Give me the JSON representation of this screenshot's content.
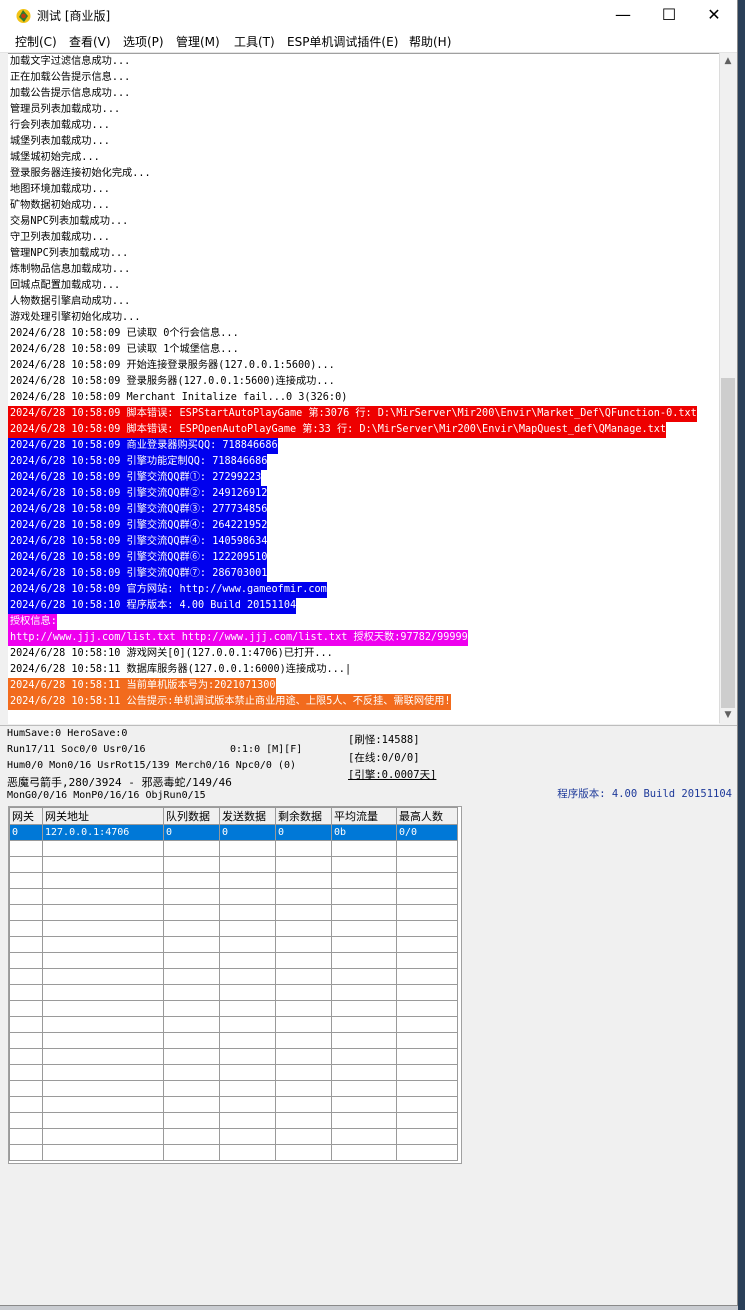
{
  "window": {
    "title": "测试 [商业版]"
  },
  "title_controls": {
    "minimize": "—",
    "maximize": "☐",
    "close": "✕"
  },
  "menu": [
    "控制(C)",
    "查看(V)",
    "选项(P)",
    "管理(M)",
    "工具(T)",
    "ESP单机调试插件(E)",
    "帮助(H)"
  ],
  "log_lines": [
    {
      "text": "加载文字过滤信息成功...",
      "bg": "#ffffff",
      "fg": "#000000"
    },
    {
      "text": "正在加载公告提示信息...",
      "bg": "#ffffff",
      "fg": "#000000"
    },
    {
      "text": "加载公告提示信息成功...",
      "bg": "#ffffff",
      "fg": "#000000"
    },
    {
      "text": "管理员列表加载成功...",
      "bg": "#ffffff",
      "fg": "#000000"
    },
    {
      "text": "行会列表加载成功...",
      "bg": "#ffffff",
      "fg": "#000000"
    },
    {
      "text": "城堡列表加载成功...",
      "bg": "#ffffff",
      "fg": "#000000"
    },
    {
      "text": "城堡城初始完成...",
      "bg": "#ffffff",
      "fg": "#000000"
    },
    {
      "text": "登录服务器连接初始化完成...",
      "bg": "#ffffff",
      "fg": "#000000"
    },
    {
      "text": "地图环境加载成功...",
      "bg": "#ffffff",
      "fg": "#000000"
    },
    {
      "text": "矿物数据初始成功...",
      "bg": "#ffffff",
      "fg": "#000000"
    },
    {
      "text": "交易NPC列表加载成功...",
      "bg": "#ffffff",
      "fg": "#000000"
    },
    {
      "text": "守卫列表加载成功...",
      "bg": "#ffffff",
      "fg": "#000000"
    },
    {
      "text": "管理NPC列表加载成功...",
      "bg": "#ffffff",
      "fg": "#000000"
    },
    {
      "text": "炼制物品信息加载成功...",
      "bg": "#ffffff",
      "fg": "#000000"
    },
    {
      "text": "回城点配置加载成功...",
      "bg": "#ffffff",
      "fg": "#000000"
    },
    {
      "text": "人物数据引擎启动成功...",
      "bg": "#ffffff",
      "fg": "#000000"
    },
    {
      "text": "游戏处理引擎初始化成功...",
      "bg": "#ffffff",
      "fg": "#000000"
    },
    {
      "text": "2024/6/28 10:58:09 已读取 0个行会信息...",
      "bg": "#ffffff",
      "fg": "#000000"
    },
    {
      "text": "2024/6/28 10:58:09 已读取 1个城堡信息...",
      "bg": "#ffffff",
      "fg": "#000000"
    },
    {
      "text": "2024/6/28 10:58:09 开始连接登录服务器(127.0.0.1:5600)...",
      "bg": "#ffffff",
      "fg": "#000000"
    },
    {
      "text": "2024/6/28 10:58:09 登录服务器(127.0.0.1:5600)连接成功...",
      "bg": "#ffffff",
      "fg": "#000000"
    },
    {
      "text": "2024/6/28 10:58:09 Merchant Initalize fail...0 3(326:0)",
      "bg": "#ffffff",
      "fg": "#000000"
    },
    {
      "text": "2024/6/28 10:58:09 脚本错误: ESPStartAutoPlayGame 第:3076 行: D:\\MirServer\\Mir200\\Envir\\Market_Def\\QFunction-0.txt",
      "bg": "#ee0000",
      "fg": "#ffffff"
    },
    {
      "text": "2024/6/28 10:58:09 脚本错误: ESPOpenAutoPlayGame 第:33 行: D:\\MirServer\\Mir200\\Envir\\MapQuest_def\\QManage.txt",
      "bg": "#ee0000",
      "fg": "#ffffff"
    },
    {
      "text": "2024/6/28 10:58:09 商业登录器购买QQ: 718846686",
      "bg": "#0000ee",
      "fg": "#ffffff"
    },
    {
      "text": "2024/6/28 10:58:09 引擎功能定制QQ: 718846686",
      "bg": "#0000ee",
      "fg": "#ffffff"
    },
    {
      "text": "2024/6/28 10:58:09 引擎交流QQ群①: 27299223",
      "bg": "#0000ee",
      "fg": "#ffffff"
    },
    {
      "text": "2024/6/28 10:58:09 引擎交流QQ群②: 249126912",
      "bg": "#0000ee",
      "fg": "#ffffff"
    },
    {
      "text": "2024/6/28 10:58:09 引擎交流QQ群③: 277734856",
      "bg": "#0000ee",
      "fg": "#ffffff"
    },
    {
      "text": "2024/6/28 10:58:09 引擎交流QQ群④: 264221952",
      "bg": "#0000ee",
      "fg": "#ffffff"
    },
    {
      "text": "2024/6/28 10:58:09 引擎交流QQ群④: 140598634",
      "bg": "#0000ee",
      "fg": "#ffffff"
    },
    {
      "text": "2024/6/28 10:58:09 引擎交流QQ群⑥: 122209510",
      "bg": "#0000ee",
      "fg": "#ffffff"
    },
    {
      "text": "2024/6/28 10:58:09 引擎交流QQ群⑦: 286703001",
      "bg": "#0000ee",
      "fg": "#ffffff"
    },
    {
      "text": "2024/6/28 10:58:09 官方网站: http://www.gameofmir.com",
      "bg": "#0000ee",
      "fg": "#ffffff"
    },
    {
      "text": "2024/6/28 10:58:10 程序版本: 4.00 Build 20151104",
      "bg": "#0000ee",
      "fg": "#ffffff"
    },
    {
      "text": "授权信息:",
      "bg": "#ee00ee",
      "fg": "#ffffff"
    },
    {
      "text": "http://www.jjj.com/list.txt http://www.jjj.com/list.txt 授权天数:97782/99999",
      "bg": "#ee00ee",
      "fg": "#ffffff"
    },
    {
      "text": "2024/6/28 10:58:10 游戏网关[0](127.0.0.1:4706)已打开...",
      "bg": "#ffffff",
      "fg": "#000000"
    },
    {
      "text": "2024/6/28 10:58:11 数据库服务器(127.0.0.1:6000)连接成功...|",
      "bg": "#ffffff",
      "fg": "#000000"
    },
    {
      "text": "2024/6/28 10:58:11 当前单机版本号为:2021071300",
      "bg": "#f26b1d",
      "fg": "#ffffff"
    },
    {
      "text": "2024/6/28 10:58:11 公告提示:单机调试版本禁止商业用途、上限5人、不反挂、需联网使用!",
      "bg": "#f26b1d",
      "fg": "#ffffff"
    }
  ],
  "status": {
    "line1": "HumSave:0 HeroSave:0",
    "line2a": "Run17/11 Soc0/0 Usr0/16",
    "line2b": "0:1:0 [M][F]",
    "line3": "Hum0/0 Mon0/16 UsrRot15/139 Merch0/16 Npc0/0 (0)",
    "line4": "恶魔弓箭手,280/3924 - 邪恶毒蛇/149/46",
    "line5": "MonG0/0/16 MonP0/16/16 ObjRun0/15",
    "refresh": "[刷怪:14588]",
    "online": "[在线:0/0/0]",
    "engine": "[引擎:0.0007天]",
    "version": "程序版本: 4.00 Build 20151104"
  },
  "gate_table": {
    "columns": [
      "网关",
      "网关地址",
      "队列数据",
      "发送数据",
      "剩余数据",
      "平均流量",
      "最高人数"
    ],
    "rows": [
      [
        "0",
        "127.0.0.1:4706",
        "0",
        "0",
        "0",
        "0b",
        "0/0"
      ]
    ]
  },
  "colors": {
    "selected_row": "#0078d7",
    "error": "#ee0000",
    "info": "#0000ee",
    "license": "#ee00ee",
    "notice": "#f26b1d"
  }
}
